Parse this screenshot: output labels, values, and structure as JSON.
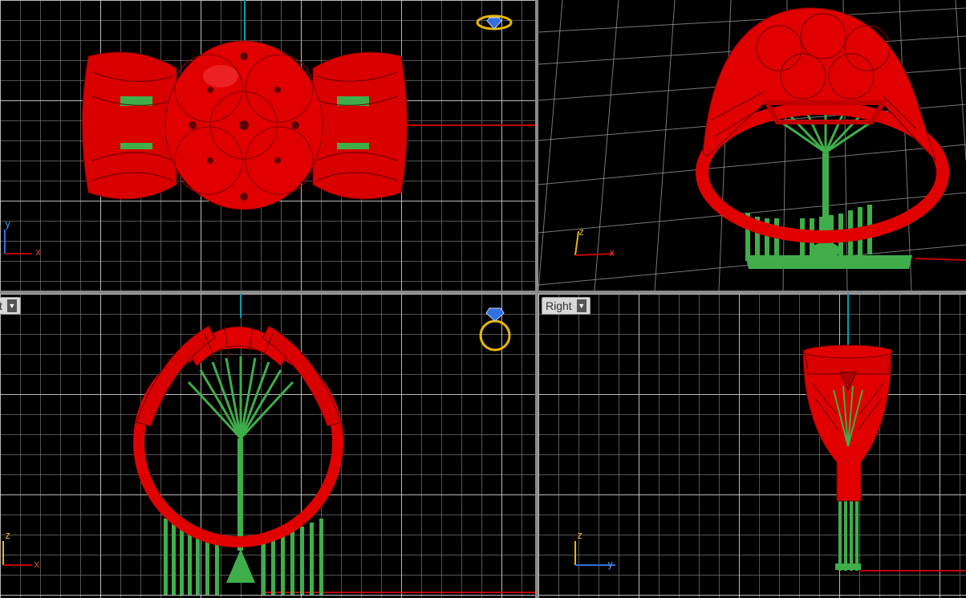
{
  "viewports": {
    "top": {
      "label": ""
    },
    "perspective": {
      "label": ""
    },
    "front": {
      "label": "t"
    },
    "right": {
      "label": "Right"
    }
  },
  "axes": {
    "top": {
      "vertical": "y",
      "horizontal": "x"
    },
    "perspective": {
      "vertical": "z",
      "horizontal": "x"
    },
    "front": {
      "vertical": "z",
      "horizontal": "x"
    },
    "right": {
      "vertical": "z",
      "horizontal": "y"
    }
  },
  "icons": {
    "top_widget": "ring-icon",
    "front_widget": "ring-icon",
    "label_menu": "dropdown-caret-icon"
  },
  "colors": {
    "model_red": "#e00000",
    "support_green": "#3fae4a",
    "axis_red": "#c00000",
    "axis_cyan": "#00a0b0",
    "axis_x_letter": "#e04040",
    "axis_y_letter": "#40a0e0",
    "axis_z_letter": "#e0c040",
    "widget_gold": "#e8b800",
    "widget_blue": "#3070e0"
  }
}
